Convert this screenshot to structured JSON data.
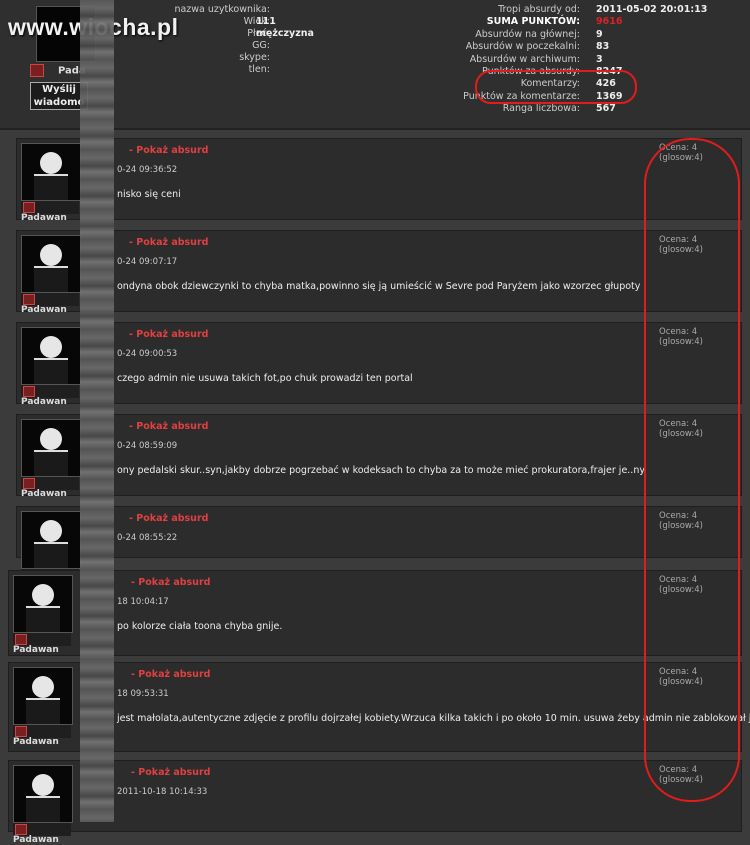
{
  "site": {
    "brand": "www.wiocha.pl"
  },
  "profile": {
    "rank": "Pada",
    "message_button": "Wyślij wiadomo",
    "labels": [
      "nazwa uzytkownika:",
      "Wiek:",
      "Płeć:",
      "GG:",
      "skype:",
      "tlen:"
    ],
    "values": [
      "111",
      "mężczyzna",
      "",
      "",
      ""
    ]
  },
  "stats": {
    "labels": [
      "Tropi absurdy od:",
      "SUMA PUNKTÓW:",
      "Absurdów na głównej:",
      "Absurdów w poczekalni:",
      "Absurdów w archiwum:",
      "Punktów za absurdy:",
      "Komentarzy:",
      "Punktów za komentarze:",
      "Ranga liczbowa:"
    ],
    "values": [
      "2011-05-02 20:01:13",
      "9616",
      "9",
      "83",
      "3",
      "8247",
      "426",
      "1369",
      "567"
    ]
  },
  "comment_common": {
    "rank": "Padawan",
    "link": "Pokaż absurd",
    "dash": "-"
  },
  "comments": [
    {
      "date": "0-24 09:36:52",
      "text": "nisko się ceni",
      "ocena": "Ocena: 4 (glosow:4)"
    },
    {
      "date": "0-24 09:07:17",
      "text": "ondyna obok dziewczynki to chyba matka,powinno się ją umieścić w Sevre pod Paryżem jako wzorzec głupoty",
      "ocena": "Ocena: 4 (glosow:4)"
    },
    {
      "date": "0-24 09:00:53",
      "text": "czego admin nie usuwa takich fot,po chuk prowadzi ten portal",
      "ocena": "Ocena: 4 (glosow:4)"
    },
    {
      "date": "0-24 08:59:09",
      "text": "ony pedalski skur..syn,jakby dobrze pogrzebać w kodeksach to chyba za to może mieć prokuratora,frajer je..ny",
      "ocena": "Ocena: 4 (glosow:4)"
    },
    {
      "date": "0-24 08:55:22",
      "text": "",
      "ocena": "Ocena: 4 (glosow:4)"
    },
    {
      "date": "18 10:04:17",
      "text": "po kolorze ciała toona chyba gnije.",
      "ocena": "Ocena: 4 (glosow:4)"
    },
    {
      "date": "18 09:53:31",
      "text": "jest małolata,autentyczne zdjęcie z profilu dojrzałej kobiety.Wrzuca kilka takich i po około 10 min. usuwa żeby admin nie zablokował jej",
      "ocena": "Ocena: 4 (glosow:4)"
    },
    {
      "date": "2011-10-18 10:14:33",
      "text": "",
      "ocena": "Ocena: 4 (glosow:4)"
    }
  ]
}
